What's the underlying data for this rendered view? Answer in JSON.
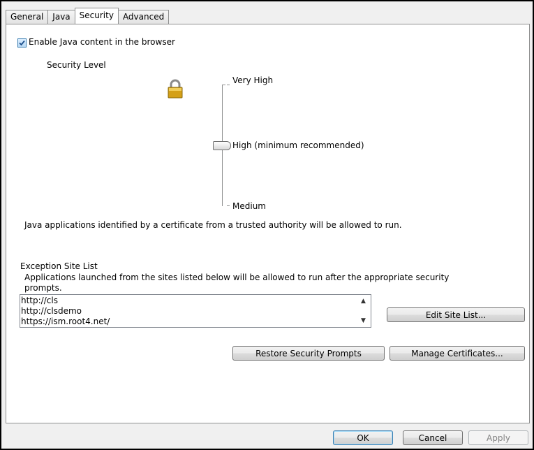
{
  "tabs": [
    {
      "label": "General"
    },
    {
      "label": "Java"
    },
    {
      "label": "Security"
    },
    {
      "label": "Advanced"
    }
  ],
  "enable_java": {
    "label": "Enable Java content in the browser",
    "checked": true
  },
  "security_level": {
    "heading": "Security Level",
    "levels": [
      "Very High",
      "High (minimum recommended)",
      "Medium"
    ],
    "selected": "High (minimum recommended)",
    "description": "Java applications identified by a certificate from a trusted authority will be allowed to run."
  },
  "exception_site_list": {
    "heading": "Exception Site List",
    "description_line1": "Applications launched from the sites listed below will be allowed to run after the appropriate security",
    "description_line2": "prompts.",
    "sites": [
      "http://cls",
      "http://clsdemo",
      "https://ism.root4.net/"
    ],
    "edit_button": "Edit Site List..."
  },
  "buttons": {
    "restore": "Restore Security Prompts",
    "manage": "Manage Certificates...",
    "ok": "OK",
    "cancel": "Cancel",
    "apply": "Apply"
  },
  "icons": {
    "lock": "padlock-icon",
    "check": "check-icon"
  },
  "colors": {
    "default_button_border": "#3c7fb1",
    "lock_gold": "#d4a017"
  }
}
